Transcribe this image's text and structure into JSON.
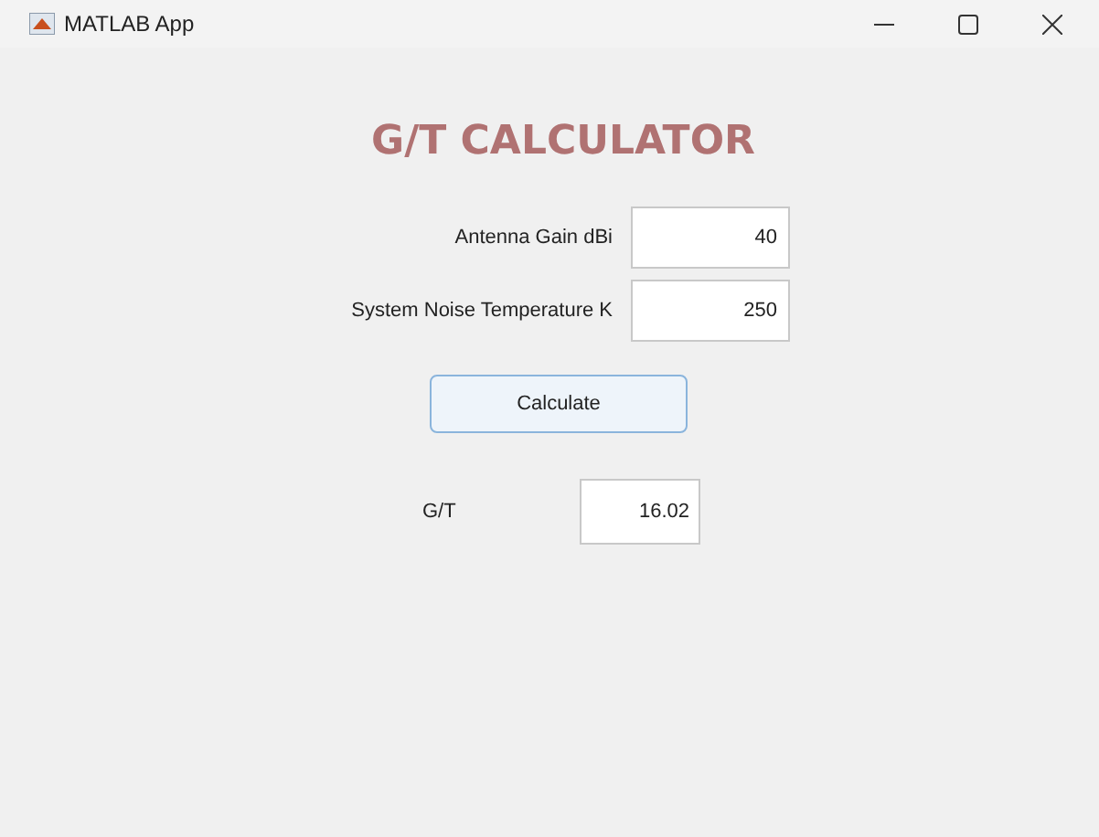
{
  "window": {
    "title": "MATLAB App"
  },
  "heading": "G/T CALCULATOR",
  "inputs": [
    {
      "label": "Antenna Gain dBi",
      "value": "40"
    },
    {
      "label": "System Noise Temperature K",
      "value": "250"
    }
  ],
  "button": {
    "label": "Calculate"
  },
  "output": {
    "label": "G/T",
    "value": "16.02"
  }
}
